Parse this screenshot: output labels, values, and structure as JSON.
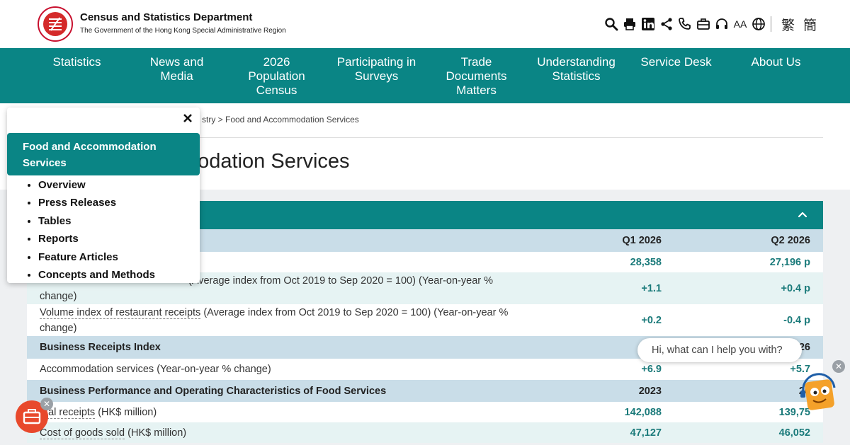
{
  "header": {
    "dept_name": "Census and Statistics Department",
    "dept_sub": "The Government of the Hong Kong Special Administrative Region",
    "font_size_label": "AA",
    "lang_trad": "繁",
    "lang_simp": "簡"
  },
  "nav": {
    "items": [
      "Statistics",
      "News and\nMedia",
      "2026\nPopulation\nCensus",
      "Participating in\nSurveys",
      "Trade\nDocuments\nMatters",
      "Understanding\nStatistics",
      "Service Desk",
      "About Us"
    ]
  },
  "breadcrumb": {
    "text": "stry > Food and Accommodation Services"
  },
  "page_title": "modation Services",
  "table": {
    "header1": {
      "label": "",
      "c1": "Q1 2026",
      "c2": "Q2 2026"
    },
    "row1": {
      "label": "",
      "c1": "28,358",
      "c2": "27,196 p"
    },
    "row2": {
      "label_link": "",
      "label_rest": "(Average index from Oct 2019 to Sep 2020 = 100) (Year-on-year % change)",
      "c1": "+1.1",
      "c2": "+0.4 p"
    },
    "row3": {
      "label_link": "Volume index of restaurant receipts",
      "label_rest": " (Average index from Oct 2019 to Sep 2020 = 100) (Year-on-year % change)",
      "c1": "+0.2",
      "c2": "-0.4 p"
    },
    "header2": {
      "label": "Business Receipts Index",
      "c1": "C",
      "c2": "26"
    },
    "row4": {
      "label": "Accommodation services (Year-on-year % change)",
      "c1": "+6.9",
      "c2": "+5.7"
    },
    "header3": {
      "label": "Business Performance and Operating Characteristics of Food Services",
      "c1": "2023",
      "c2": "20"
    },
    "row5": {
      "label_link": "otal receipts",
      "label_rest": " (HK$ million)",
      "c1": "142,088",
      "c2": "139,75"
    },
    "row6": {
      "label_link": "Cost of goods sold",
      "label_rest": " (HK$ million)",
      "c1": "47,127",
      "c2": "46,052"
    }
  },
  "side_menu": {
    "title": "Food and Accommodation Services",
    "items": [
      "Overview",
      "Press Releases",
      "Tables",
      "Reports",
      "Feature Articles",
      "Concepts and Methods"
    ]
  },
  "chat": {
    "prompt": "Hi, what can I help you with?"
  },
  "colors": {
    "teal": "#0a8585",
    "header_row": "#c9dde8",
    "tint_row": "#e6f3f3",
    "brand_red": "#c8102e",
    "fab": "#e8492c"
  }
}
